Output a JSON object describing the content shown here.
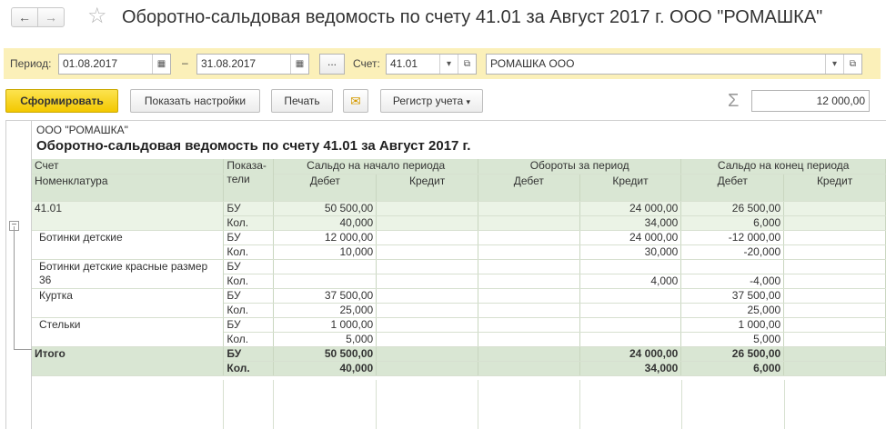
{
  "window": {
    "title": "Оборотно-сальдовая ведомость по счету 41.01 за Август 2017 г. ООО \"РОМАШКА\"",
    "nav_back": "←",
    "nav_forward": "→",
    "favorite_icon": "star-icon"
  },
  "params": {
    "period_label": "Период:",
    "date_from": "01.08.2017",
    "dash": "–",
    "date_to": "31.08.2017",
    "dots": "...",
    "account_label": "Счет:",
    "account": "41.01",
    "organization": "РОМАШКА ООО"
  },
  "toolbar": {
    "generate": "Сформировать",
    "show_settings": "Показать настройки",
    "print": "Печать",
    "register": "Регистр учета",
    "sigma": "Σ",
    "total_value": "12 000,00"
  },
  "report": {
    "organization": "ООО \"РОМАШКА\"",
    "title": "Оборотно-сальдовая ведомость по счету 41.01 за Август 2017 г.",
    "headers": {
      "account": "Счет",
      "nomenclature": "Номенклатура",
      "indicators": "Показа-тели",
      "opening": "Сальдо на начало периода",
      "turnover": "Обороты за период",
      "closing": "Сальдо на конец периода",
      "debit": "Дебет",
      "credit": "Кредит"
    },
    "rows": [
      {
        "name": "41.01",
        "ind": "БУ",
        "v": [
          "50 500,00",
          "",
          "",
          "24 000,00",
          "26 500,00",
          ""
        ],
        "kind": "acc"
      },
      {
        "name": "",
        "ind": "Кол.",
        "v": [
          "40,000",
          "",
          "",
          "34,000",
          "6,000",
          ""
        ],
        "kind": "acc"
      },
      {
        "name": "Ботинки детские",
        "ind": "БУ",
        "v": [
          "12 000,00",
          "",
          "",
          "24 000,00",
          "-12 000,00",
          ""
        ],
        "kind": "item"
      },
      {
        "name": "",
        "ind": "Кол.",
        "v": [
          "10,000",
          "",
          "",
          "30,000",
          "-20,000",
          ""
        ],
        "kind": "item"
      },
      {
        "name": "Ботинки детские красные размер",
        "ind": "БУ",
        "v": [
          "",
          "",
          "",
          "",
          "",
          ""
        ],
        "kind": "item"
      },
      {
        "name": "36",
        "ind": "Кол.",
        "v": [
          "",
          "",
          "",
          "4,000",
          "-4,000",
          ""
        ],
        "kind": "item"
      },
      {
        "name": "Куртка",
        "ind": "БУ",
        "v": [
          "37 500,00",
          "",
          "",
          "",
          "37 500,00",
          ""
        ],
        "kind": "item"
      },
      {
        "name": "",
        "ind": "Кол.",
        "v": [
          "25,000",
          "",
          "",
          "",
          "25,000",
          ""
        ],
        "kind": "item"
      },
      {
        "name": "Стельки",
        "ind": "БУ",
        "v": [
          "1 000,00",
          "",
          "",
          "",
          "1 000,00",
          ""
        ],
        "kind": "item"
      },
      {
        "name": "",
        "ind": "Кол.",
        "v": [
          "5,000",
          "",
          "",
          "",
          "5,000",
          ""
        ],
        "kind": "item"
      },
      {
        "name": "Итого",
        "ind": "БУ",
        "v": [
          "50 500,00",
          "",
          "",
          "24 000,00",
          "26 500,00",
          ""
        ],
        "kind": "tot"
      },
      {
        "name": "",
        "ind": "Кол.",
        "v": [
          "40,000",
          "",
          "",
          "34,000",
          "6,000",
          ""
        ],
        "kind": "tot"
      }
    ]
  },
  "colors": {
    "accent_yellow": "#f3c800",
    "params_bg": "#fbf0b9",
    "header_green": "#d9e6d3",
    "negative_red": "#d21f1f"
  }
}
